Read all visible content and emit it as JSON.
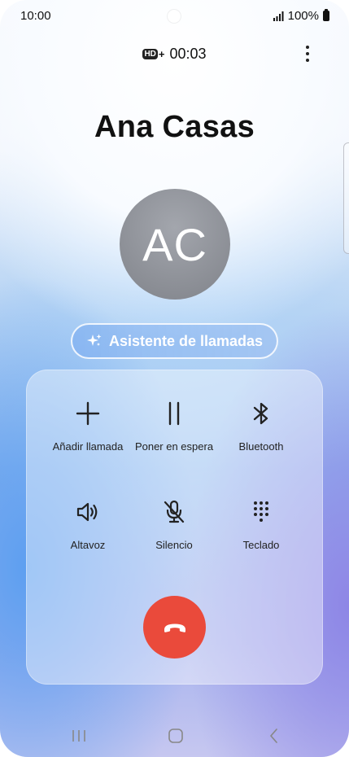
{
  "status_bar": {
    "time": "10:00",
    "battery_text": "100%"
  },
  "call": {
    "hd_label": "HD",
    "hd_plus": "+",
    "duration": "00:03",
    "contact_name": "Ana Casas",
    "avatar_initials": "AC"
  },
  "assistant": {
    "label": "Asistente de llamadas"
  },
  "controls": {
    "add_call": "Añadir llamada",
    "hold": "Poner en espera",
    "bluetooth": "Bluetooth",
    "speaker": "Altavoz",
    "mute": "Silencio",
    "keypad": "Teclado"
  },
  "colors": {
    "end_call": "#ea4a3b",
    "avatar": "#8e9198",
    "text_primary": "#111111"
  },
  "icons": {
    "add_call": "plus-icon",
    "hold": "pause-icon",
    "bluetooth": "bluetooth-icon",
    "speaker": "speaker-icon",
    "mute": "microphone-off-icon",
    "keypad": "keypad-icon",
    "end_call": "phone-hangup-icon",
    "assistant": "sparkle-icon"
  }
}
